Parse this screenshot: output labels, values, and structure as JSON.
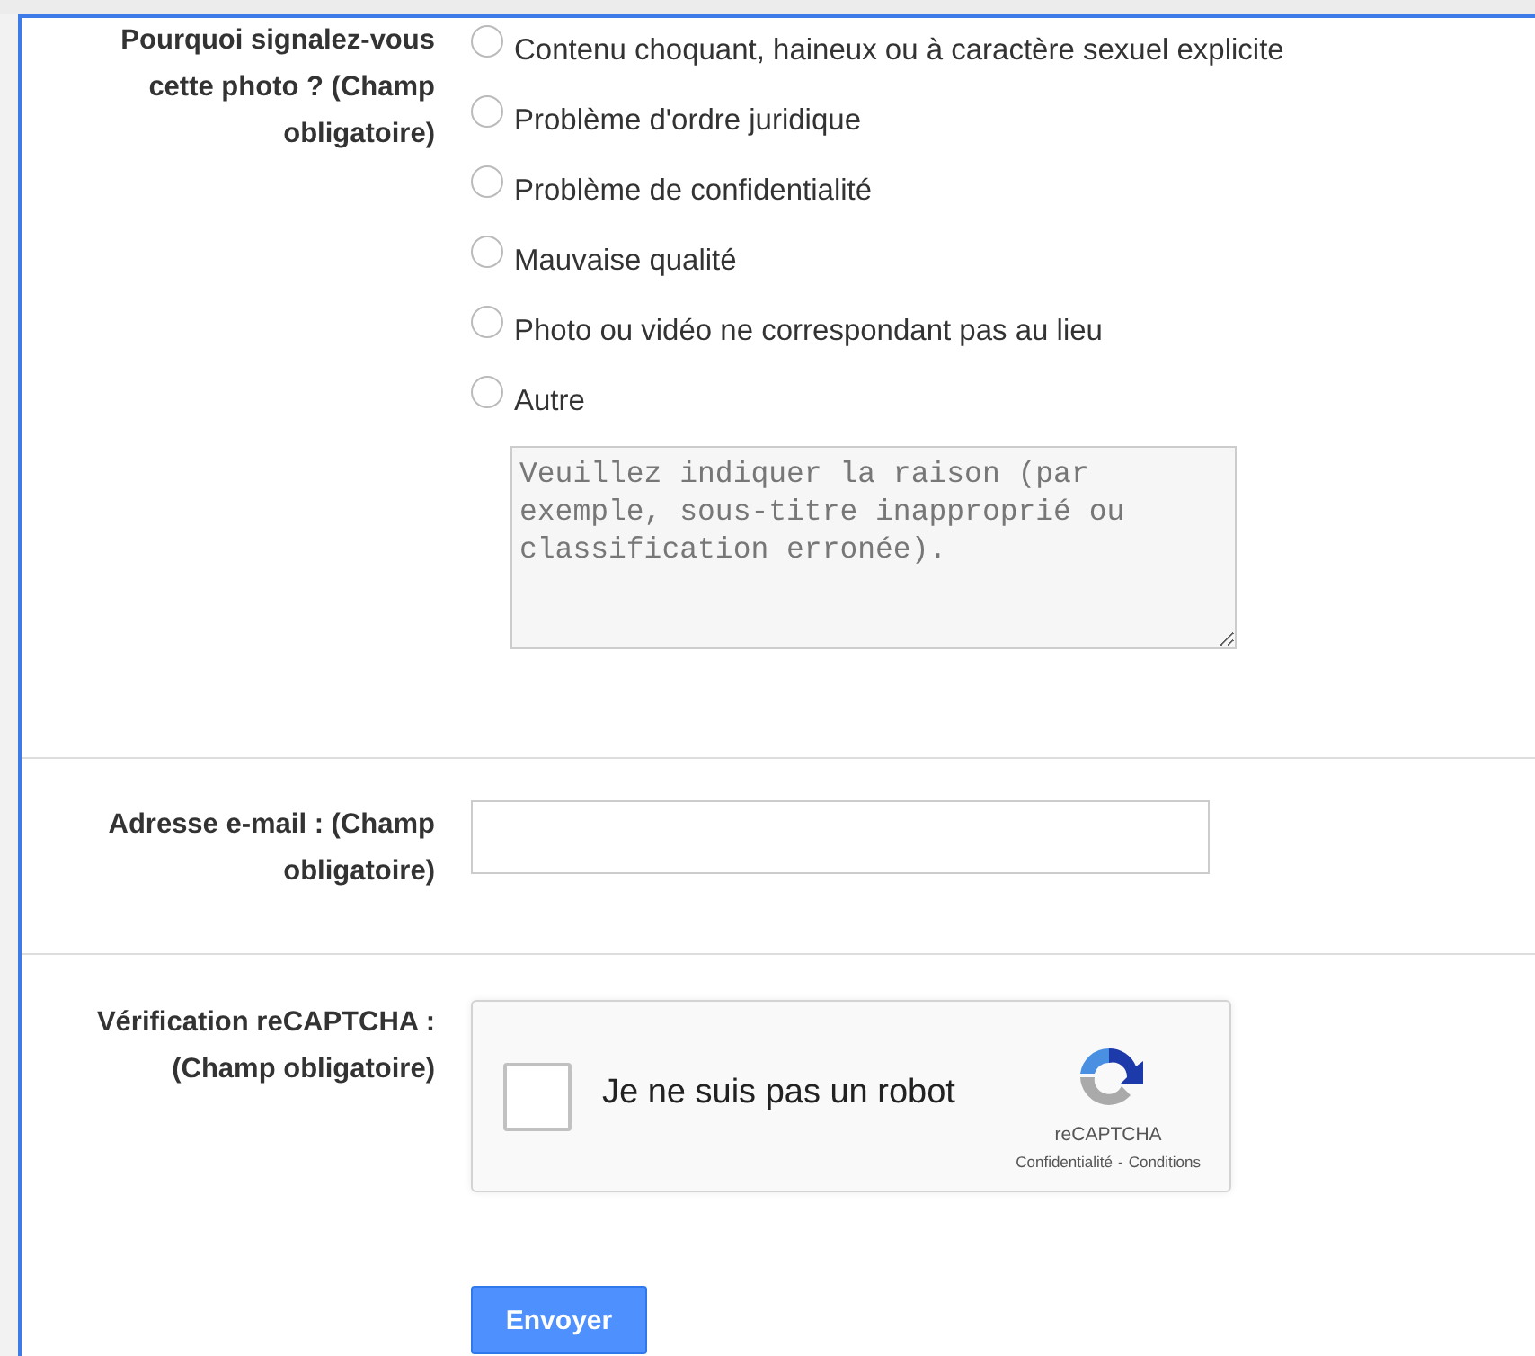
{
  "reason": {
    "label": "Pourquoi signalez-vous cette photo ? (Champ obligatoire)",
    "options": [
      {
        "label": "Contenu choquant, haineux ou à caractère sexuel explicite",
        "selected": false
      },
      {
        "label": "Problème d'ordre juridique",
        "selected": false
      },
      {
        "label": "Problème de confidentialité",
        "selected": false
      },
      {
        "label": "Mauvaise qualité",
        "selected": false
      },
      {
        "label": "Photo ou vidéo ne correspondant pas au lieu",
        "selected": false
      },
      {
        "label": "Autre",
        "selected": false
      }
    ],
    "details": {
      "placeholder": "Veuillez indiquer la raison (par exemple, sous-titre inapproprié ou classification erronée)."
    }
  },
  "email": {
    "label": "Adresse e-mail : (Champ obligatoire)"
  },
  "captcha": {
    "label": "Vérification reCAPTCHA : (Champ obligatoire)",
    "checkbox_label": "Je ne suis pas un robot",
    "checked": false,
    "brand": "reCAPTCHA",
    "links": [
      "Confidentialité",
      "Conditions"
    ],
    "separator": "-"
  },
  "submit": "Envoyer"
}
